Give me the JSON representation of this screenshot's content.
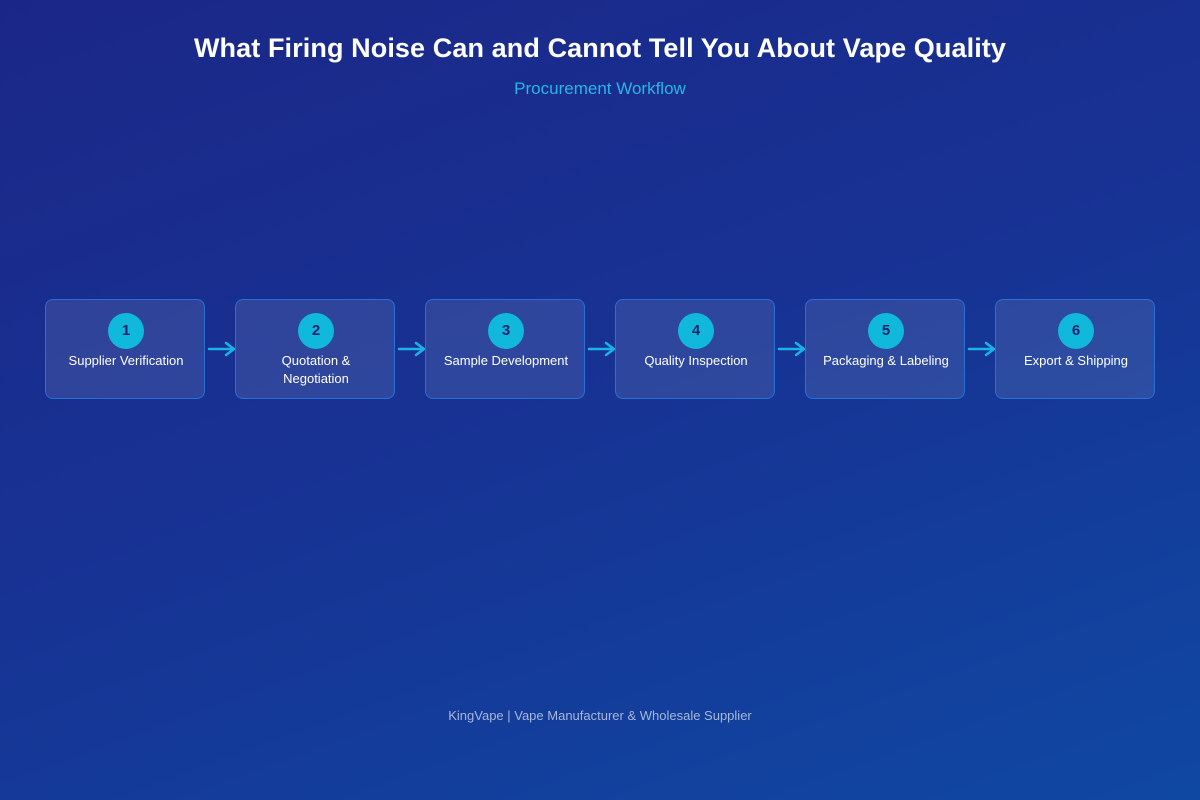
{
  "title": "What Firing Noise Can and Cannot Tell You About Vape Quality",
  "subtitle": "Procurement Workflow",
  "steps": [
    {
      "number": "1",
      "label": "Supplier Verification"
    },
    {
      "number": "2",
      "label": "Quotation & Negotiation"
    },
    {
      "number": "3",
      "label": "Sample Development"
    },
    {
      "number": "4",
      "label": "Quality Inspection"
    },
    {
      "number": "5",
      "label": "Packaging & Labeling"
    },
    {
      "number": "6",
      "label": "Export & Shipping"
    }
  ],
  "footer": "KingVape | Vape Manufacturer & Wholesale Supplier",
  "colors": {
    "accent": "#29b6e6",
    "badge": "#10b9dc",
    "border": "#2a6fd6",
    "arrow": "#19b4e6"
  },
  "icons": {
    "connector": "right-arrow-icon"
  }
}
